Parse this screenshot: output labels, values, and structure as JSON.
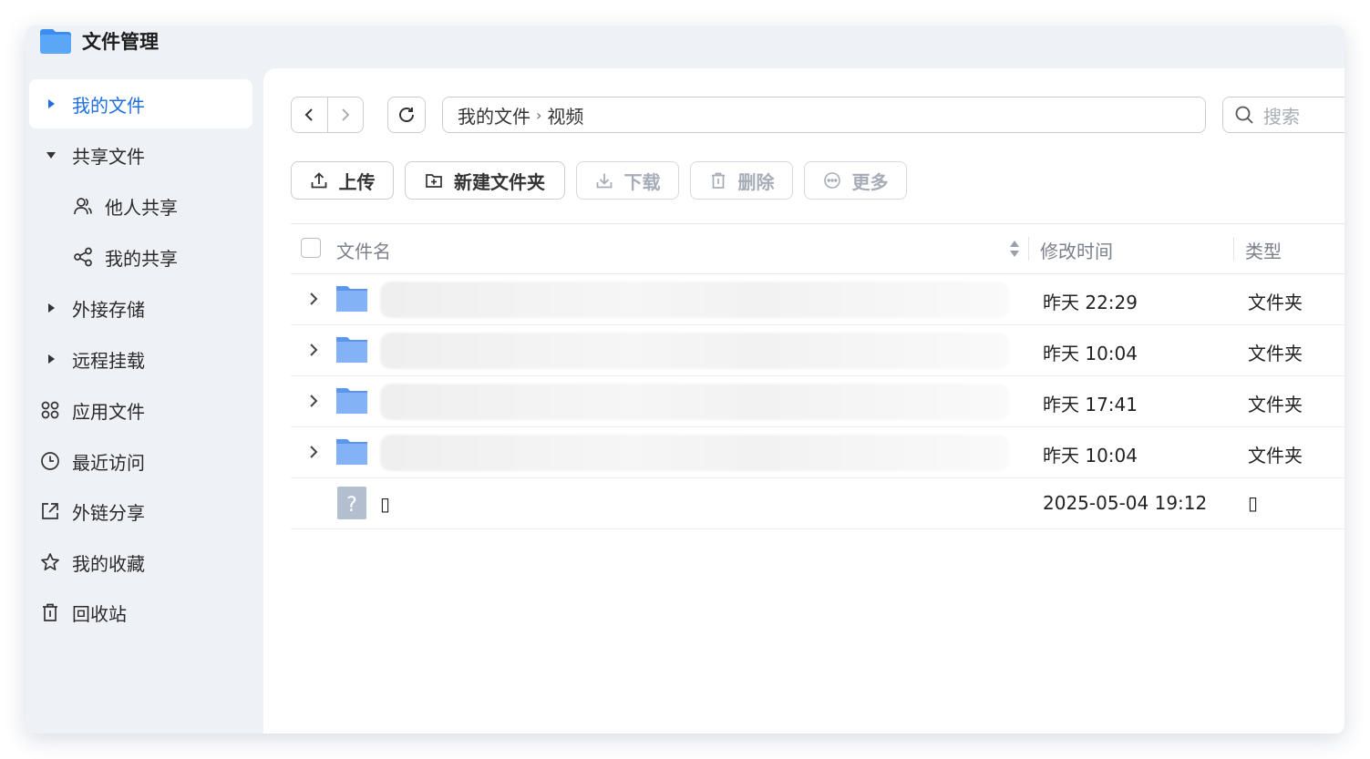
{
  "app": {
    "title": "文件管理",
    "icon": "folder-app-icon",
    "accent": "#1f6fe0"
  },
  "sidebar": {
    "items": [
      {
        "label": "我的文件",
        "icon": "caret-right-icon",
        "active": true
      },
      {
        "label": "共享文件",
        "icon": "caret-down-icon"
      },
      {
        "label": "他人共享",
        "icon": "users-icon"
      },
      {
        "label": "我的共享",
        "icon": "share-icon"
      },
      {
        "label": "外接存储",
        "icon": "caret-right-icon"
      },
      {
        "label": "远程挂载",
        "icon": "caret-right-icon"
      },
      {
        "label": "应用文件",
        "icon": "apps-icon"
      },
      {
        "label": "最近访问",
        "icon": "clock-icon"
      },
      {
        "label": "外链分享",
        "icon": "external-share-icon"
      },
      {
        "label": "我的收藏",
        "icon": "star-icon"
      },
      {
        "label": "回收站",
        "icon": "trash-icon"
      }
    ]
  },
  "path": {
    "segments": [
      "我的文件",
      "视频"
    ],
    "separator": "›"
  },
  "search": {
    "placeholder": "搜索"
  },
  "toolbar": {
    "upload": "上传",
    "new_folder": "新建文件夹",
    "download": "下载",
    "delete": "删除",
    "more": "更多"
  },
  "table": {
    "columns": {
      "name": "文件名",
      "modified": "修改时间",
      "type": "类型"
    },
    "rows": [
      {
        "name": "",
        "modified": "昨天 22:29",
        "type": "文件夹",
        "kind": "folder",
        "blurred": true
      },
      {
        "name": "",
        "modified": "昨天 10:04",
        "type": "文件夹",
        "kind": "folder",
        "blurred": true
      },
      {
        "name": "",
        "modified": "昨天 17:41",
        "type": "文件夹",
        "kind": "folder",
        "blurred": true
      },
      {
        "name": "",
        "modified": "昨天 10:04",
        "type": "文件夹",
        "kind": "folder",
        "blurred": true
      },
      {
        "name": "▯",
        "modified": "2025-05-04 19:12",
        "type": "▯",
        "kind": "unknown"
      }
    ]
  }
}
